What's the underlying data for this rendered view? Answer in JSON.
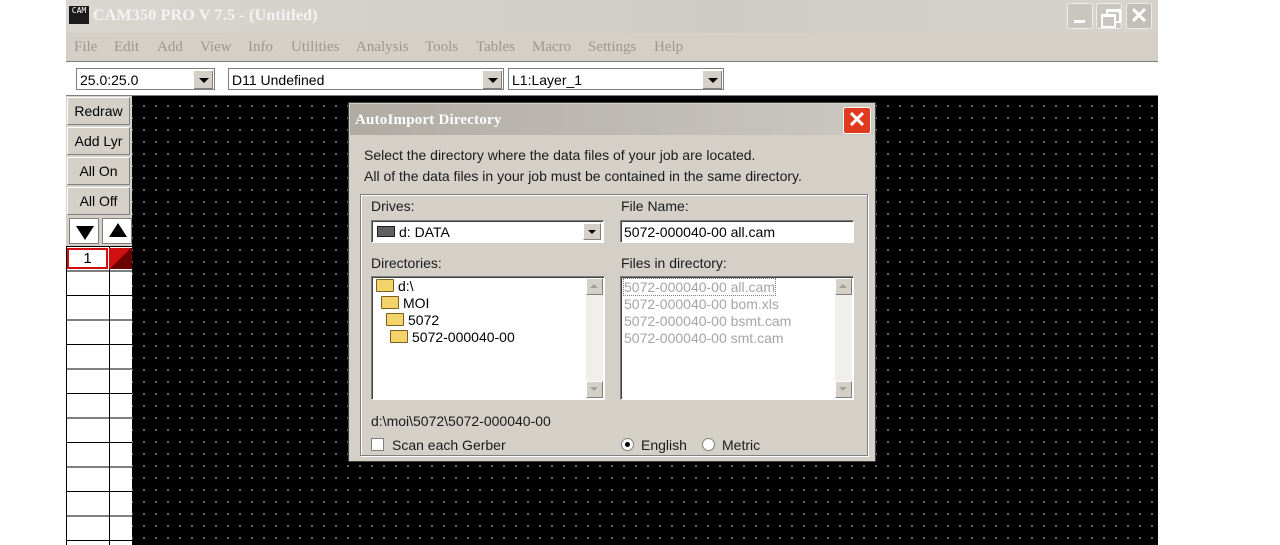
{
  "window": {
    "title": "CAM350 PRO V 7.5 - (Untitled)",
    "icon_label": "CAM"
  },
  "menu": [
    "File",
    "Edit",
    "Add",
    "View",
    "Info",
    "Utilities",
    "Analysis",
    "Tools",
    "Tables",
    "Macro",
    "Settings",
    "Help"
  ],
  "toolbar": {
    "grid": "25.0:25.0",
    "dcode": "D11  Undefined",
    "layer": "L1:Layer_1"
  },
  "left_panel": {
    "buttons": [
      "Redraw",
      "Add Lyr",
      "All On",
      "All Off"
    ],
    "layer_number": "1",
    "layer_color": "#d01010"
  },
  "dialog": {
    "title": "AutoImport Directory",
    "line1": "Select the directory where the data files of your job are located.",
    "line2": "All of the data files in your job must be contained in the same directory.",
    "drives_label": "Drives:",
    "drive_value": "d: DATA",
    "file_name_label": "File Name:",
    "file_name_value": "5072-000040-00 all.cam",
    "directories_label": "Directories:",
    "directories": [
      "d:\\",
      "MOI",
      "5072",
      "5072-000040-00"
    ],
    "files_label": "Files in directory:",
    "files": [
      "5072-000040-00 all.cam",
      "5072-000040-00 bom.xls",
      "5072-000040-00 bsmt.cam",
      "5072-000040-00 smt.cam"
    ],
    "current_path": "d:\\moi\\5072\\5072-000040-00",
    "scan_label": "Scan each Gerber",
    "unit_english": "English",
    "unit_metric": "Metric"
  }
}
